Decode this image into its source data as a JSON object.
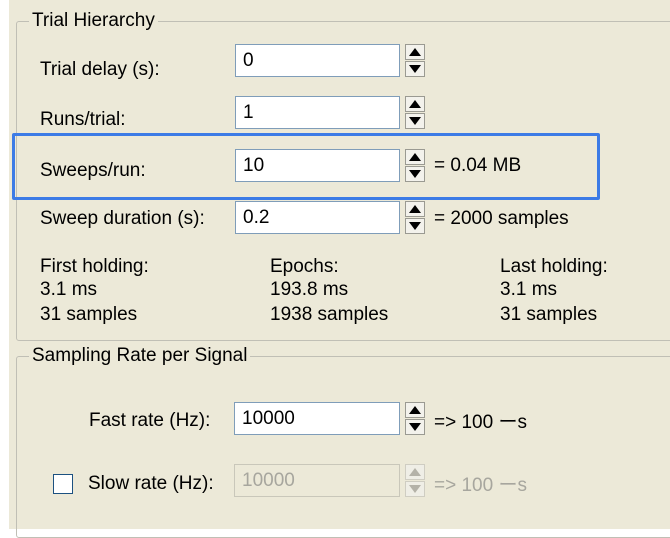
{
  "trial_hierarchy": {
    "title": "Trial Hierarchy",
    "trial_delay": {
      "label": "Trial delay (s):",
      "value": "0"
    },
    "runs_per_trial": {
      "label": "Runs/trial:",
      "value": "1"
    },
    "sweeps_per_run": {
      "label": "Sweeps/run:",
      "value": "10",
      "info": "= 0.04 MB"
    },
    "sweep_duration": {
      "label": "Sweep duration (s):",
      "value": "0.2",
      "info": "= 2000 samples"
    },
    "first_holding": {
      "label": "First holding:",
      "time": "3.1 ms",
      "samples": "31 samples"
    },
    "epochs": {
      "label": "Epochs:",
      "time": "193.8 ms",
      "samples": "1938 samples"
    },
    "last_holding": {
      "label": "Last holding:",
      "time": "3.1 ms",
      "samples": "31 samples"
    }
  },
  "sampling": {
    "title": "Sampling Rate per Signal",
    "fast_rate": {
      "label": "Fast rate  (Hz):",
      "value": "10000",
      "info": "=> 100 ーs"
    },
    "slow_rate": {
      "label": "Slow rate (Hz):",
      "value": "10000",
      "info": "=> 100 ーs",
      "checked": false,
      "enabled": false
    }
  },
  "colors": {
    "highlight": "#3c7be6",
    "panel": "#ece9d8",
    "field_border": "#7f9db9"
  }
}
